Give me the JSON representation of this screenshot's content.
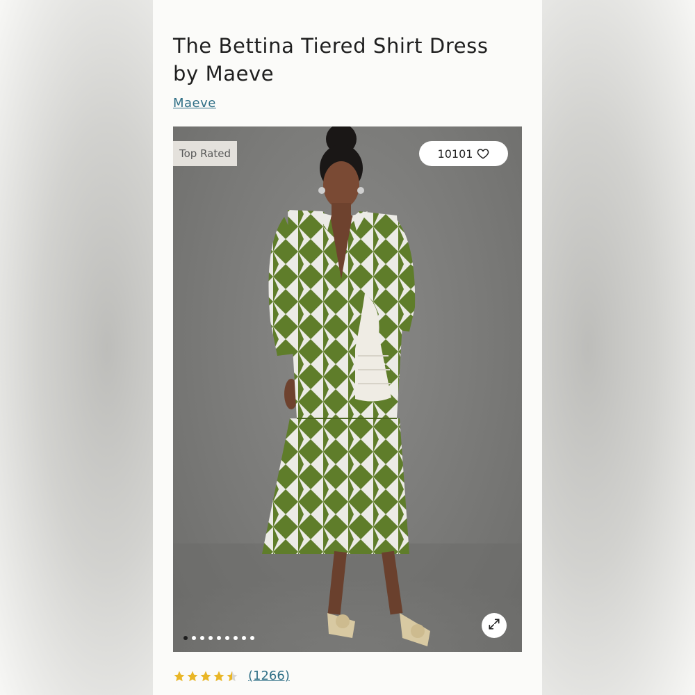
{
  "product": {
    "title": "The Bettina Tiered Shirt Dress by Maeve",
    "brand": "Maeve"
  },
  "gallery": {
    "badge": "Top Rated",
    "favorites_count": "10101",
    "dots_total": 9,
    "active_dot": 0,
    "image_alt": "Model wearing green and white geometric tiered shirt dress with white pleated bag and beige bow heels"
  },
  "rating": {
    "stars": 4.5,
    "reviews": "(1266)"
  },
  "colors": {
    "link": "#2f6f86",
    "dress_green": "#5f7d2a",
    "star": "#e9b627"
  },
  "icons": [
    "heart-icon",
    "expand-icon",
    "star-icon"
  ]
}
